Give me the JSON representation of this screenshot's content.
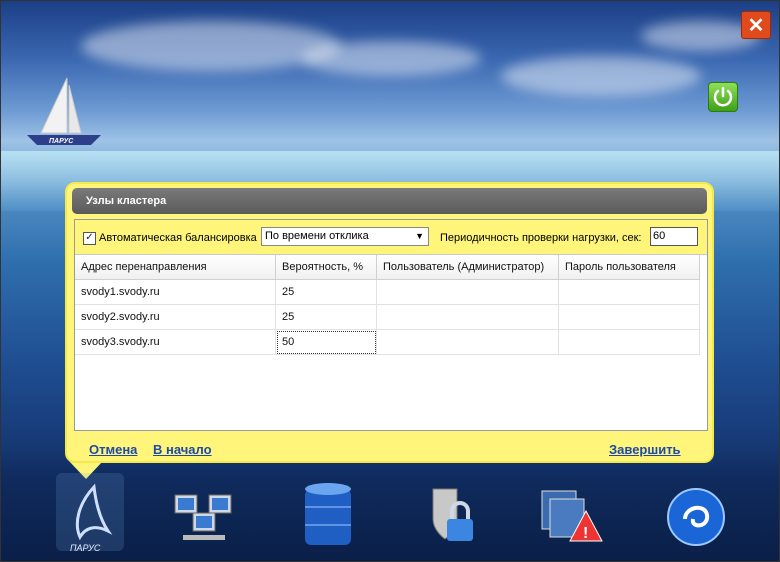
{
  "panel": {
    "title": "Узлы кластера",
    "auto_balance": {
      "checked": true,
      "label": "Автоматическая балансировка"
    },
    "mode_select": {
      "value": "По времени отклика"
    },
    "period": {
      "label": "Периодичность проверки нагрузки, сек:",
      "value": "60"
    },
    "table": {
      "columns": [
        "Адрес перенаправления",
        "Вероятность, %",
        "Пользователь (Администратор)",
        "Пароль пользователя"
      ],
      "rows": [
        [
          "svody1.svody.ru",
          "25",
          "",
          ""
        ],
        [
          "svody2.svody.ru",
          "25",
          "",
          ""
        ],
        [
          "svody3.svody.ru",
          "50",
          "",
          ""
        ]
      ]
    },
    "footer": {
      "cancel": "Отмена",
      "back": "В начало",
      "finish": "Завершить"
    }
  },
  "brand": {
    "logo_text": "ПАРУС"
  },
  "icons": {
    "close": "close-icon",
    "power": "power-icon",
    "dock": [
      "parus-logo-icon",
      "network-computers-icon",
      "database-icon",
      "shield-lock-icon",
      "warning-windows-icon",
      "globe-swirl-icon"
    ]
  },
  "colors": {
    "panel_bg": "#fef57a",
    "header_bg": "#6a6a6a",
    "link": "#1f4aa8",
    "close_bg": "#e04a1c",
    "power_bg": "#4fb822"
  }
}
